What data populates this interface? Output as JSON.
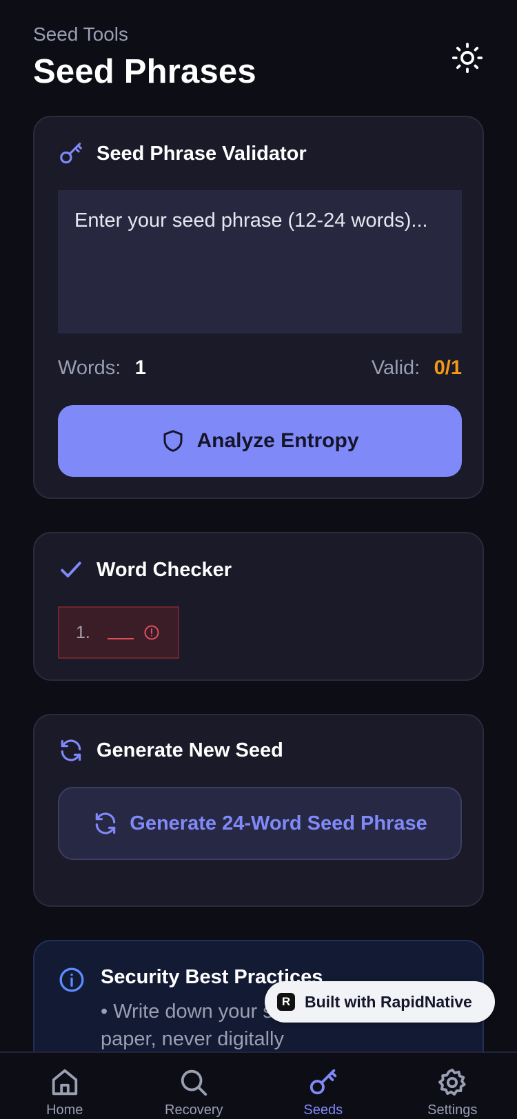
{
  "header": {
    "eyebrow": "Seed Tools",
    "title": "Seed Phrases",
    "theme_icon": "sun-icon"
  },
  "validator": {
    "title": "Seed Phrase Validator",
    "icon": "key-icon",
    "input_placeholder": "Enter your seed phrase (12-24 words)...",
    "input_value": "",
    "words_label": "Words:",
    "words_value": "1",
    "valid_label": "Valid:",
    "valid_value": "0/1",
    "analyze_label": "Analyze Entropy"
  },
  "word_checker": {
    "title": "Word Checker",
    "icon": "check-icon",
    "words": [
      {
        "num": "1.",
        "status": "invalid"
      }
    ]
  },
  "generate": {
    "title": "Generate New Seed",
    "icon": "refresh-icon",
    "button_label": "Generate 24-Word Seed Phrase"
  },
  "security": {
    "title": "Security Best Practices",
    "icon": "info-icon",
    "text": "• Write down your seed phrase on paper, never digitally"
  },
  "badge": {
    "logo": "R",
    "label": "Built with RapidNative"
  },
  "tabs": [
    {
      "label": "Home",
      "icon": "home-icon",
      "active": false
    },
    {
      "label": "Recovery",
      "icon": "search-icon",
      "active": false
    },
    {
      "label": "Seeds",
      "icon": "key-icon",
      "active": true
    },
    {
      "label": "Settings",
      "icon": "gear-icon",
      "active": false
    }
  ],
  "colors": {
    "background": "#0d0d16",
    "card": "#1a1a29",
    "accent": "#8089f8",
    "valid_orange": "#f29a18",
    "error_red": "#e0505c"
  }
}
